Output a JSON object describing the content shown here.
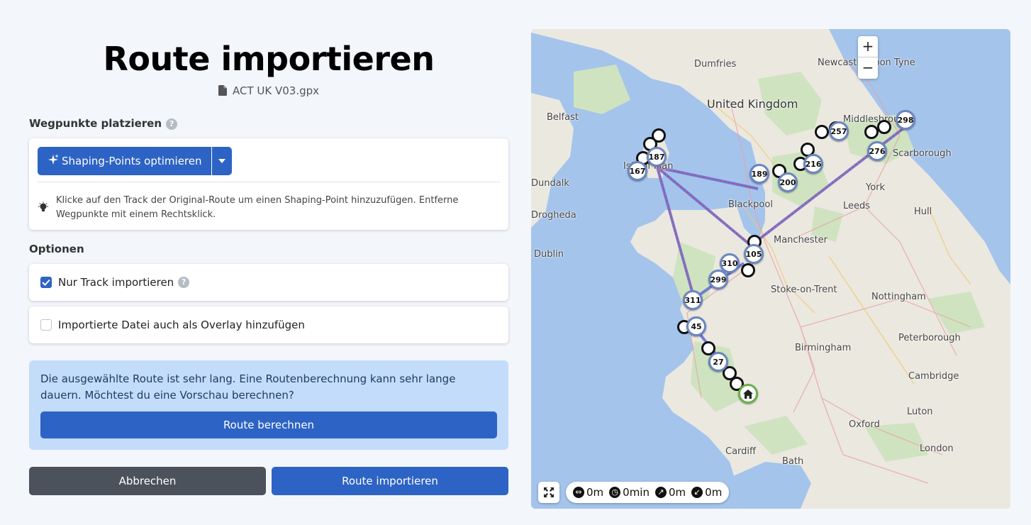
{
  "page": {
    "title": "Route importieren",
    "filename": "ACT UK V03.gpx",
    "file_icon": "file-icon"
  },
  "waypoints": {
    "label": "Wegpunkte platzieren",
    "help": "?",
    "optimize_button": "Shaping-Points optimieren",
    "hint": "Klicke auf den Track der Original-Route um einen Shaping-Point hinzuzufügen. Entferne Wegpunkte mit einem Rechtsklick."
  },
  "options": {
    "label": "Optionen",
    "track_only": {
      "label": "Nur Track importieren",
      "checked": true,
      "help": "?"
    },
    "overlay": {
      "label": "Importierte Datei auch als Overlay hinzufügen",
      "checked": false
    }
  },
  "alert": {
    "text": "Die ausgewählte Route ist sehr lang. Eine Routenberechnung kann sehr lange dauern. Möchtest du eine Vorschau berechnen?",
    "button": "Route berechnen"
  },
  "footer": {
    "cancel": "Abbrechen",
    "import": "Route importieren"
  },
  "map": {
    "zoom_in": "+",
    "zoom_out": "−",
    "stats": {
      "distance": "0m",
      "duration": "0min",
      "ascent": "0m",
      "descent": "0m"
    },
    "places": [
      "Dumfries",
      "Newcastle upon Tyne",
      "United Kingdom",
      "Belfast",
      "Isle of Man",
      "Blackpool",
      "Leeds",
      "York",
      "Hull",
      "Scarborough",
      "Manchester",
      "Stoke-on-Trent",
      "Nottingham",
      "Dublin",
      "Birmingham",
      "Peterborough",
      "Cambridge",
      "Luton",
      "Oxford",
      "London",
      "Cardiff",
      "Bath",
      "Dundalk",
      "Drogheda",
      "Middlesbrough"
    ],
    "waypoint_labels": [
      "298",
      "187",
      "310",
      "299",
      "311",
      "45",
      "167",
      "189",
      "200",
      "216",
      "257",
      "276",
      "105",
      "27"
    ],
    "colors": {
      "route": "#6a6fd6",
      "route_accent": "#d6485a",
      "water": "#a4c4ec",
      "land": "#ebe8e0",
      "green": "#cfe3c0"
    }
  }
}
